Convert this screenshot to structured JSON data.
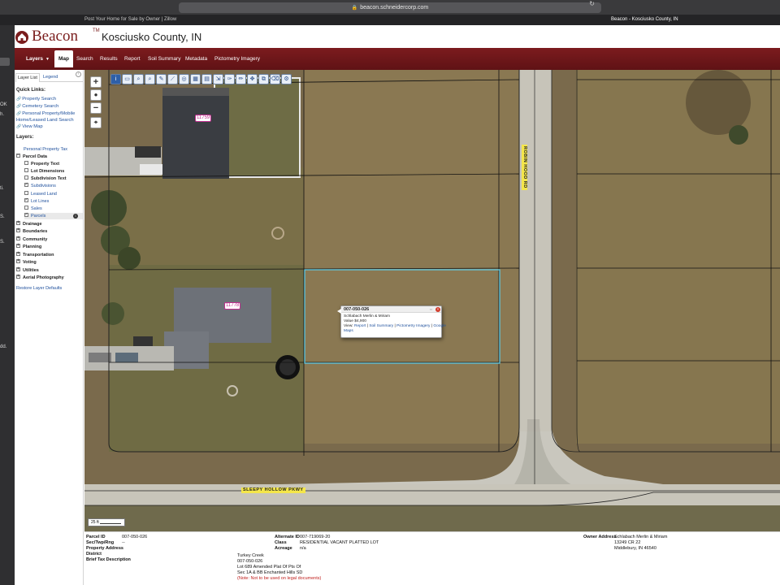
{
  "browser": {
    "url": "beacon.schneidercorp.com",
    "tabs": [
      {
        "title": "Post Your Home for Sale by Owner | Zillow"
      },
      {
        "title": "Beacon - Kosciusko County, IN"
      }
    ]
  },
  "background_window": {
    "fragments": [
      "OK",
      "h.",
      "ti.",
      "S.",
      "S.",
      "dd."
    ]
  },
  "header": {
    "logo_text": "Beacon",
    "logo_tm": "TM",
    "county_title": "Kosciusko County, IN"
  },
  "nav": {
    "layers": "Layers",
    "map": "Map",
    "search": "Search",
    "results": "Results",
    "report": "Report",
    "soil_summary": "Soil Summary",
    "metadata": "Metadata",
    "pictometry": "Pictometry Imagery"
  },
  "sidebar": {
    "tabs": {
      "layer_list": "Layer List",
      "legend": "Legend"
    },
    "quick_links_heading": "Quick Links:",
    "quick_links": [
      "Property Search",
      "Cemetery Search",
      "Personal Property/Mobile Home/Leased Land Search",
      "View Map"
    ],
    "quick_link_labels": {
      "property_search": "Property Search",
      "cemetery_search": "Cemetery Search",
      "personal_line1": "Personal Property/Mobile",
      "personal_line2": "Home/Leased Land Search",
      "view_map": "View Map"
    },
    "layers_heading": "Layers:",
    "layers": {
      "personal_property_tax": "Personal Property Tax",
      "parcel_data": "Parcel Data",
      "property_text": "Property Text",
      "lot_dimensions": "Lot Dimensions",
      "subdivision_text": "Subdivision Text",
      "subdivisions": "Subdivisions",
      "leased_land": "Leased Land",
      "lot_lines": "Lot Lines",
      "sales": "Sales",
      "parcels": "Parcels",
      "drainage": "Drainage",
      "boundaries": "Boundaries",
      "community": "Community",
      "planning": "Planning",
      "transportation": "Transportation",
      "voting": "Voting",
      "utilities": "Utilities",
      "aerial_photography": "Aerial Photography"
    },
    "restore_defaults": "Restore Layer Defaults"
  },
  "map": {
    "address_labels": {
      "north_house": "11759",
      "south_house": "11778"
    },
    "road_labels": {
      "robin_hood": "ROBIN HOOD RD",
      "sleepy_hollow": "SLEEPY HOLLOW PKWY"
    },
    "scale_bar": "25 ft",
    "selected_parcel_outline_color": "#5fd3f0",
    "popup": {
      "parcel_id": "007-050-026",
      "owner": "Schlabach Merlin & Miriam",
      "value": "Value $4,900",
      "view_label": "View:",
      "links": [
        "Report",
        "Soil Summary",
        "Pictometry Imagery",
        "Google Maps"
      ],
      "link_labels": {
        "report": "Report",
        "soil_summary": "Soil Summary",
        "pictometry": "Pictometry Imagery",
        "google": "Google",
        "maps": "Maps"
      },
      "separator": "|"
    }
  },
  "parcel_info": {
    "labels": {
      "parcel_id": "Parcel ID",
      "sec_twp_rng": "Sec/Twp/Rng",
      "property_address": "Property Address",
      "district": "District",
      "brief_tax_description": "Brief Tax Description",
      "alternate_id": "Alternate ID",
      "class": "Class",
      "acreage": "Acreage",
      "owner_address": "Owner Address"
    },
    "values": {
      "parcel_id": "007-050-026",
      "sec_twp_rng": "--",
      "alternate_id": "007-719069-20",
      "class": "RESIDENTIAL VACANT PLATTED LOT",
      "acreage": "n/a",
      "owner_line1": "Schlabach Merlin & Miriam",
      "owner_line2": "13249 CR 22",
      "owner_line3": "Middlebury, IN 46540",
      "district": "Turkey Creek",
      "tax_line1": "007-050-026",
      "tax_line2": "Lot 689 Amended Plat Of Pts Of",
      "tax_line3": "Sec 1A & BB Enchanted Hills SD",
      "tax_note": "(Note: Not to be used on legal documents)"
    }
  },
  "colors": {
    "brand": "#7a1d1d",
    "nav_bg": "#6e171a",
    "link": "#1d4f9c"
  },
  "icons": {
    "toolbar": [
      "identify-icon",
      "select-icon",
      "measure-icon",
      "draw-icon",
      "print-icon",
      "buffer-icon",
      "layers-icon",
      "pan-icon"
    ]
  }
}
